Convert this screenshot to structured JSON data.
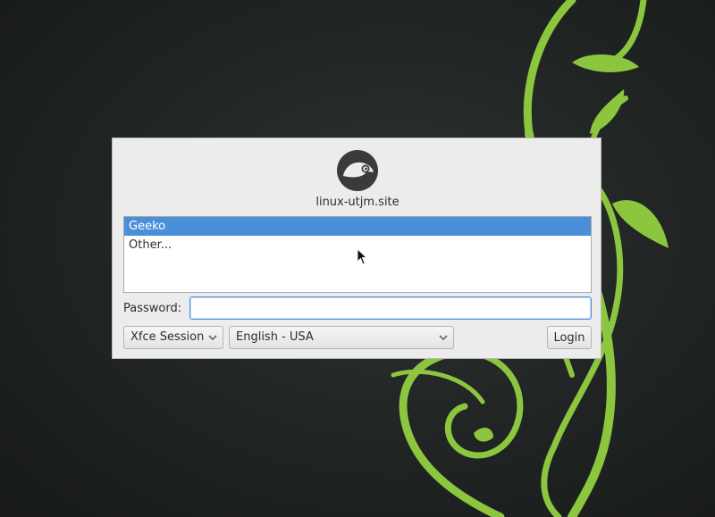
{
  "background": {
    "color": "#1f2322",
    "accent": "#73ba25"
  },
  "dialog": {
    "logo_icon": "opensuse-chameleon-icon",
    "hostname": "linux-utjm.site",
    "users": [
      {
        "label": "Geeko",
        "selected": true
      },
      {
        "label": "Other...",
        "selected": false
      }
    ],
    "password_label": "Password:",
    "password_value": "",
    "session": "Xfce Session",
    "language": "English - USA",
    "login_label": "Login",
    "selection_color": "#4a90d9"
  }
}
